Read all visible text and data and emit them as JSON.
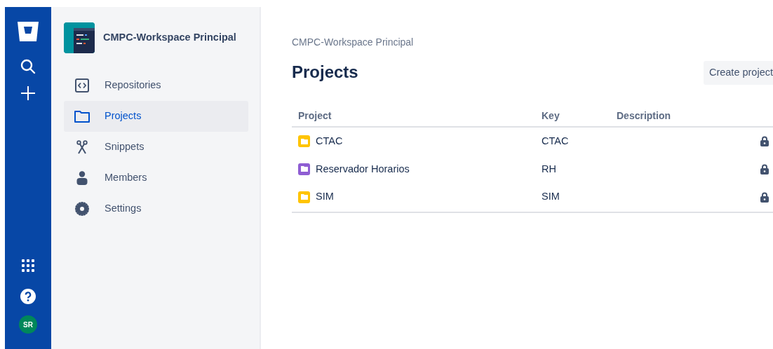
{
  "workspace": {
    "name": "CMPC-Workspace Principal"
  },
  "sidebar": {
    "items": [
      {
        "label": "Repositories",
        "kind": "code",
        "selected": false
      },
      {
        "label": "Projects",
        "kind": "folder",
        "selected": true
      },
      {
        "label": "Snippets",
        "kind": "scissors",
        "selected": false
      },
      {
        "label": "Members",
        "kind": "person",
        "selected": false
      },
      {
        "label": "Settings",
        "kind": "gear",
        "selected": false
      }
    ]
  },
  "rail": {
    "avatar": "SR"
  },
  "breadcrumb": "CMPC-Workspace Principal",
  "title": "Projects",
  "create_button": "Create project",
  "table": {
    "columns": [
      "Project",
      "Key",
      "Description"
    ],
    "rows": [
      {
        "project": "CTAC",
        "key": "CTAC",
        "color": "#ffc400",
        "private": true
      },
      {
        "project": "Reservador Horarios",
        "key": "RH",
        "color": "#8f5ed3",
        "private": true
      },
      {
        "project": "SIM",
        "key": "SIM",
        "color": "#ffc400",
        "private": true
      }
    ]
  }
}
